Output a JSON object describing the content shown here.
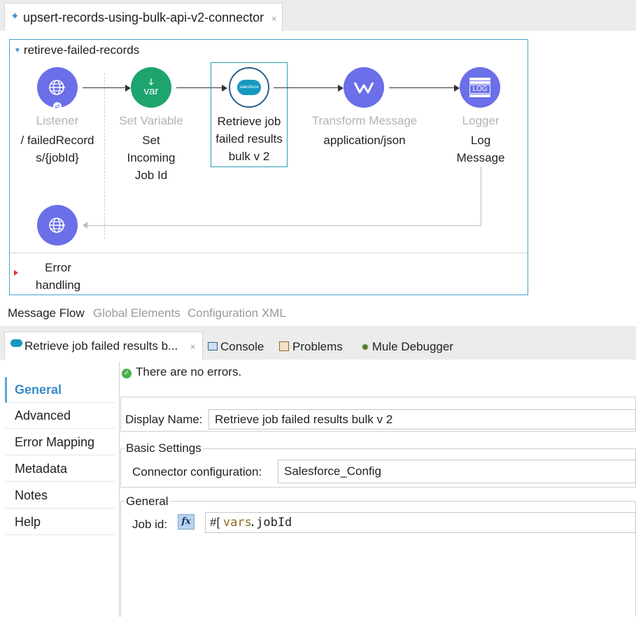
{
  "editor_tab": {
    "title": "upsert-records-using-bulk-api-v2-connector",
    "close": "×"
  },
  "flow": {
    "name": "retireve-failed-records",
    "nodes": [
      {
        "type": "Listener",
        "label": "/ failedRecord s/{jobId}"
      },
      {
        "type": "Set Variable",
        "label": "Set Incoming Job Id",
        "icon_text": "var"
      },
      {
        "type": "",
        "label": "Retrieve job failed results bulk v 2",
        "icon_text": "salesforce"
      },
      {
        "type": "Transform Message",
        "label": "application/json"
      },
      {
        "type": "Logger",
        "label": "Log Message",
        "icon_text": "LOG"
      }
    ],
    "error_handling": "Error handling"
  },
  "canvas_tabs": [
    "Message Flow",
    "Global Elements",
    "Configuration XML"
  ],
  "panel_tabs": [
    {
      "label": "Retrieve job failed results b...",
      "close": "×"
    },
    {
      "label": "Console"
    },
    {
      "label": "Problems"
    },
    {
      "label": "Mule Debugger"
    }
  ],
  "sidebar": [
    "General",
    "Advanced",
    "Error Mapping",
    "Metadata",
    "Notes",
    "Help"
  ],
  "status": "There are no errors.",
  "form": {
    "display_name_label": "Display Name:",
    "display_name_value": "Retrieve job failed results bulk v 2",
    "basic_settings": "Basic Settings",
    "connector_label": "Connector configuration:",
    "connector_value": "Salesforce_Config",
    "general_group": "General",
    "jobid_label": "Job id:",
    "fx": "fx",
    "expr_prefix": "#[",
    "expr_vars": "vars",
    "expr_rest": ".jobId"
  },
  "colors": {
    "accent": "#3d8fd1",
    "node_purple": "#6b6fe8",
    "node_green": "#1ea46e",
    "selection": "#2a9fb0"
  }
}
